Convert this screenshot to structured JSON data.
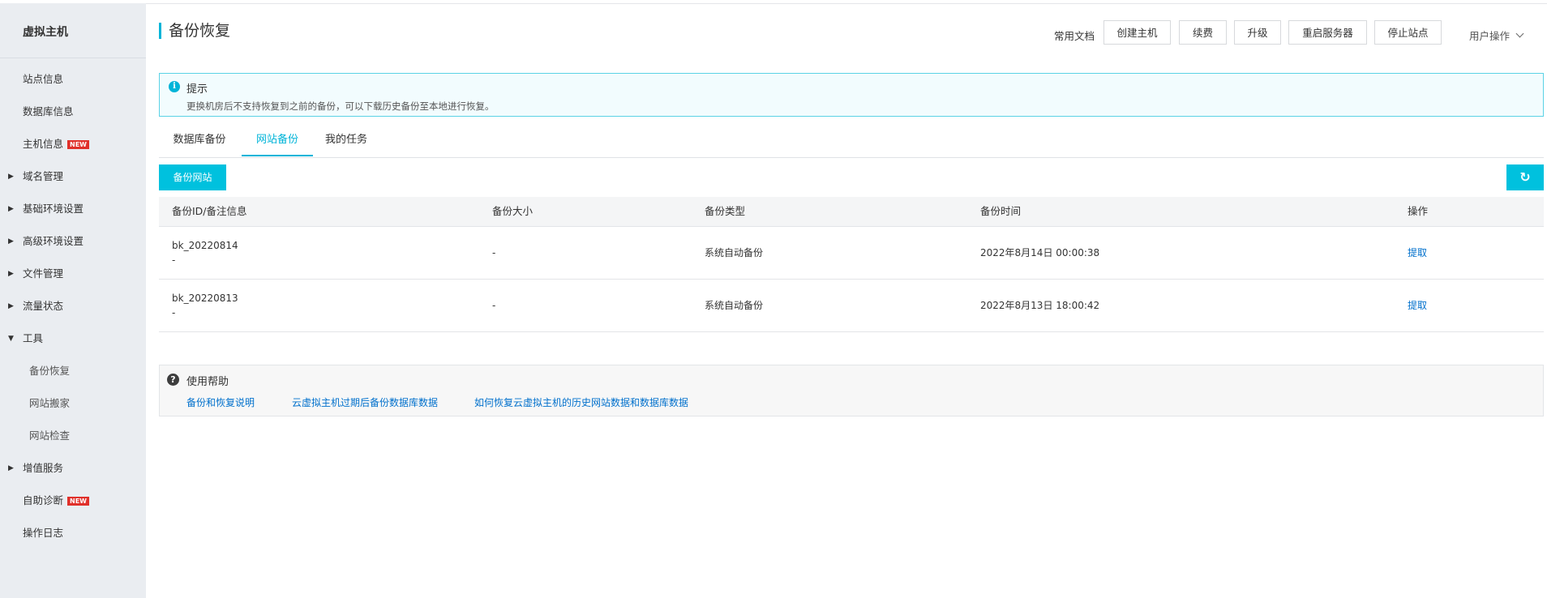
{
  "sidebar": {
    "title": "虚拟主机",
    "items": [
      {
        "label": "站点信息"
      },
      {
        "label": "数据库信息"
      },
      {
        "label": "主机信息",
        "badge": "NEW"
      },
      {
        "label": "域名管理",
        "arrow": "▶"
      },
      {
        "label": "基础环境设置",
        "arrow": "▶"
      },
      {
        "label": "高级环境设置",
        "arrow": "▶"
      },
      {
        "label": "文件管理",
        "arrow": "▶"
      },
      {
        "label": "流量状态",
        "arrow": "▶"
      },
      {
        "label": "工具",
        "arrow": "▼"
      },
      {
        "label": "备份恢复"
      },
      {
        "label": "网站搬家"
      },
      {
        "label": "网站检查"
      },
      {
        "label": "增值服务",
        "arrow": "▶"
      },
      {
        "label": "自助诊断",
        "badge": "NEW"
      },
      {
        "label": "操作日志"
      }
    ]
  },
  "header": {
    "title": "备份恢复",
    "doc_label": "常用文档",
    "buttons": [
      "创建主机",
      "续费",
      "升级",
      "重启服务器",
      "停止站点"
    ],
    "user_menu": "用户操作"
  },
  "notice": {
    "icon": "info-icon",
    "title": "提示",
    "text": "更换机房后不支持恢复到之前的备份，可以下载历史备份至本地进行恢复。"
  },
  "tabs": [
    "数据库备份",
    "网站备份",
    "我的任务"
  ],
  "active_tab": "网站备份",
  "toolbar": {
    "backup_button": "备份网站",
    "refresh_icon": "refresh-icon",
    "refresh_glyph": "↻"
  },
  "table": {
    "columns": [
      "备份ID/备注信息",
      "备份大小",
      "备份类型",
      "备份时间",
      "操作"
    ],
    "rows": [
      {
        "id": "bk_20220814",
        "note": "-",
        "size": "-",
        "type": "系统自动备份",
        "time": "2022年8月14日 00:00:38",
        "action": "提取"
      },
      {
        "id": "bk_20220813",
        "note": "-",
        "size": "-",
        "type": "系统自动备份",
        "time": "2022年8月13日 18:00:42",
        "action": "提取"
      }
    ]
  },
  "help": {
    "icon": "help-icon",
    "title": "使用帮助",
    "links": [
      "备份和恢复说明",
      "云虚拟主机过期后备份数据库数据",
      "如何恢复云虚拟主机的历史网站数据和数据库数据"
    ]
  },
  "colors": {
    "accent": "#00c1de",
    "link": "#0070cc",
    "new_badge": "#e0302a",
    "sidebar_bg": "#eaedf1"
  }
}
